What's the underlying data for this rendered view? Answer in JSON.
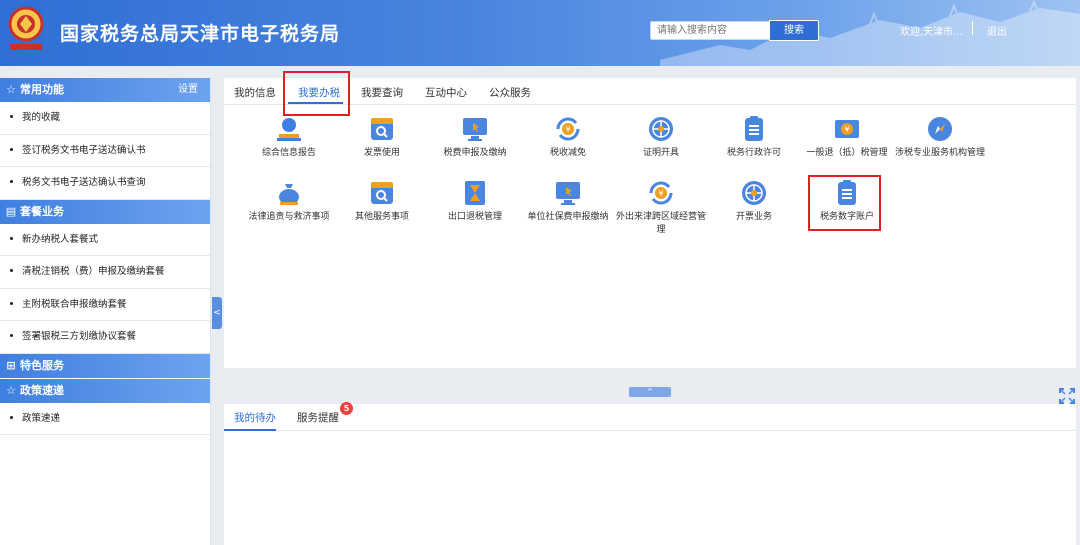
{
  "header": {
    "title": "国家税务总局天津市电子税务局",
    "search_placeholder": "请输入搜索内容",
    "search_button": "搜索",
    "welcome": "欢迎,天津市...",
    "logout": "退出",
    "brand_color": "#2f6fd4"
  },
  "sidebar": {
    "sections": [
      {
        "title": "常用功能",
        "icon": "star-icon",
        "setting": "设置",
        "items": [
          "我的收藏",
          "签订税务文书电子送达确认书",
          "税务文书电子送达确认书查询"
        ]
      },
      {
        "title": "套餐业务",
        "icon": "stack-icon",
        "items": [
          "新办纳税人套餐式",
          "清税注销税（费）申报及缴纳套餐",
          "主附税联合申报缴纳套餐",
          "签署银税三方划缴协议套餐"
        ]
      },
      {
        "title": "特色服务",
        "icon": "grid-icon",
        "items": []
      },
      {
        "title": "政策速递",
        "icon": "star-icon",
        "items": [
          "政策速递"
        ]
      }
    ],
    "collapse_glyph": "<"
  },
  "main": {
    "tabs": [
      "我的信息",
      "我要办税",
      "我要查询",
      "互动中心",
      "公众服务"
    ],
    "active_tab": "我要办税",
    "items": [
      {
        "label": "综合信息报告",
        "icon": "person-tray-icon"
      },
      {
        "label": "发票使用",
        "icon": "invoice-search-icon"
      },
      {
        "label": "税费申报及缴纳",
        "icon": "monitor-cursor-icon"
      },
      {
        "label": "税收减免",
        "icon": "yuan-refresh-icon"
      },
      {
        "label": "证明开具",
        "icon": "globe-icon"
      },
      {
        "label": "税务行政许可",
        "icon": "document-icon"
      },
      {
        "label": "一般退（抵）税管理",
        "icon": "yuan-card-icon"
      },
      {
        "label": "涉税专业服务机构管理",
        "icon": "compass-icon"
      },
      {
        "label": "法律追责与救济事项",
        "icon": "money-bag-icon"
      },
      {
        "label": "其他服务事项",
        "icon": "invoice-search-icon"
      },
      {
        "label": "出口退税管理",
        "icon": "hourglass-icon"
      },
      {
        "label": "单位社保费申报缴纳",
        "icon": "monitor-cursor-icon"
      },
      {
        "label": "外出来津跨区域经营管理",
        "icon": "yuan-refresh-icon"
      },
      {
        "label": "开票业务",
        "icon": "globe-icon"
      },
      {
        "label": "税务数字账户",
        "icon": "document-icon"
      }
    ],
    "highlight_color": "#e02020",
    "expand_glyph": "^"
  },
  "lower": {
    "tabs": [
      "我的待办",
      "服务提醒"
    ],
    "active_tab": "我的待办",
    "badge_count": "5"
  }
}
